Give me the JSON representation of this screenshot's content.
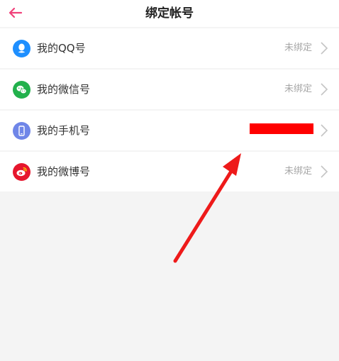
{
  "header": {
    "title": "绑定帐号",
    "back_icon": "arrow-left-icon",
    "accent_color": "#f0417a"
  },
  "accounts": [
    {
      "label": "我的QQ号",
      "status": "未绑定",
      "icon": "qq-icon",
      "icon_color": "#1e8fff"
    },
    {
      "label": "我的微信号",
      "status": "未绑定",
      "icon": "wechat-icon",
      "icon_color": "#22b14c"
    },
    {
      "label": "我的手机号",
      "status": "",
      "icon": "phone-icon",
      "icon_color": "#6f86e8"
    },
    {
      "label": "我的微博号",
      "status": "未绑定",
      "icon": "weibo-icon",
      "icon_color": "#e6162d"
    }
  ],
  "annotation": {
    "arrow_color": "#ee1a1a",
    "redaction_color": "#ff0000"
  }
}
